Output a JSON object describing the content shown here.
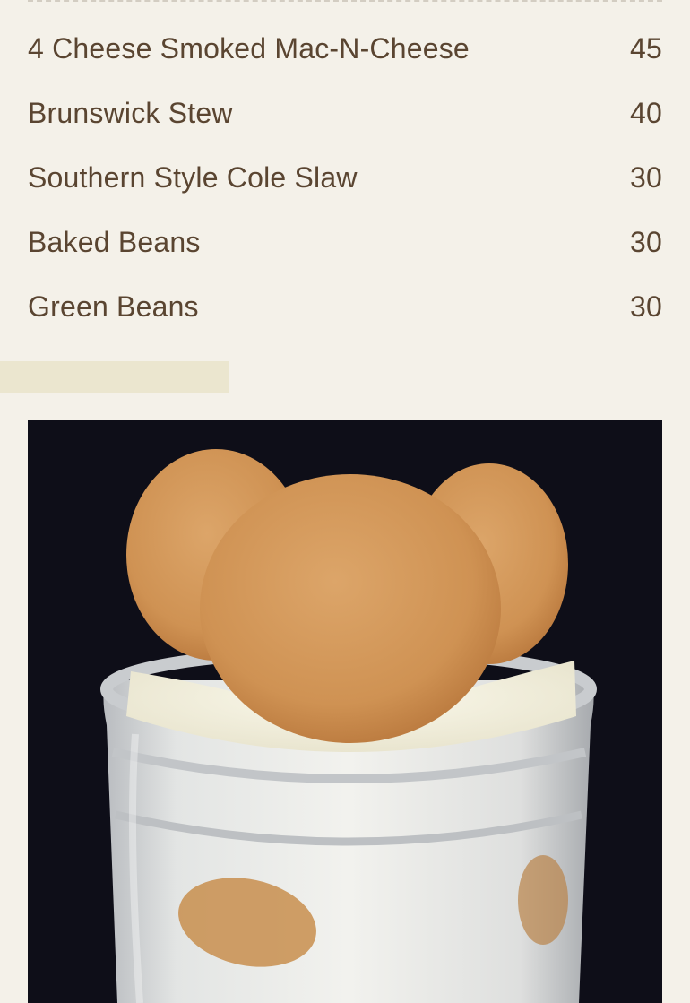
{
  "menu": {
    "items": [
      {
        "name": "4 Cheese Smoked Mac-N-Cheese",
        "price": "45"
      },
      {
        "name": "Brunswick Stew",
        "price": "40"
      },
      {
        "name": "Southern Style Cole Slaw",
        "price": "30"
      },
      {
        "name": "Baked Beans",
        "price": "30"
      },
      {
        "name": "Green Beans",
        "price": "30"
      }
    ]
  },
  "colors": {
    "background": "#f4f1e9",
    "text": "#5a4531",
    "tab": "#ebe6cf",
    "photo_background": "#0e0e18"
  },
  "photo": {
    "icon": "banana-pudding-jar-photo"
  }
}
